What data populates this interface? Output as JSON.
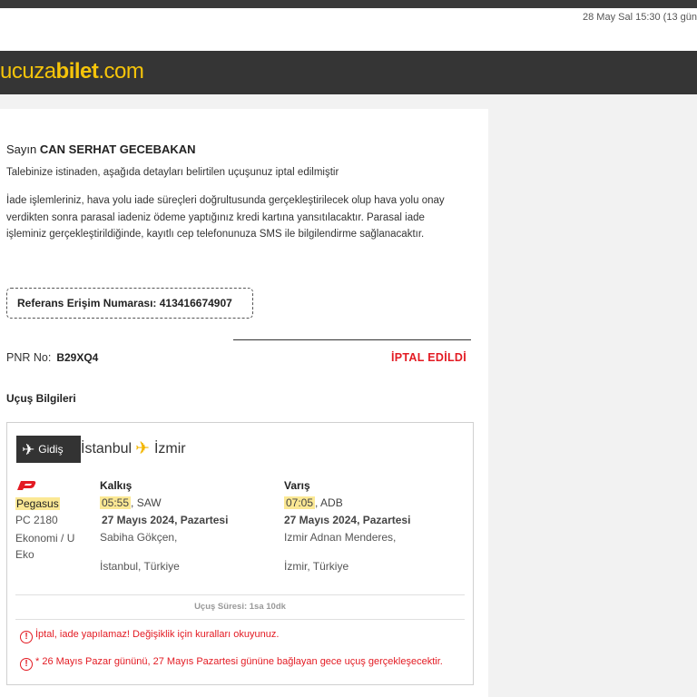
{
  "mail": {
    "date": "28 May Sal 15:30 (13 gün"
  },
  "brand": {
    "logo_part1": "ucuza",
    "logo_part2": "bilet",
    "logo_part3": ".com",
    "color": "#f5c40a"
  },
  "greeting": {
    "prefix": "Sayın",
    "name": "CAN SERHAT GECEBAKAN"
  },
  "message": {
    "line1": "Talebinize istinaden, aşağıda detayları belirtilen uçuşunuz iptal edilmiştir",
    "line2": "İade işlemleriniz, hava yolu iade süreçleri doğrultusunda gerçekleştirilecek olup hava yolu onay verdikten sonra parasal iadeniz ödeme yaptığınız kredi kartına yansıtılacaktır. Parasal iade işleminiz gerçekleştirildiğinde, kayıtlı cep telefonunuza SMS ile bilgilendirme sağlanacaktır."
  },
  "reference": {
    "text": "Referans Erişim Numarası: 413416674907"
  },
  "pnr": {
    "label": "PNR No:",
    "value": "B29XQ4",
    "status": "İPTAL EDİLDİ",
    "status_color": "#e31b23"
  },
  "flight_section": {
    "title": "Uçuş Bilgileri"
  },
  "flight": {
    "direction_label": "Gidiş",
    "from_city": "İstanbul",
    "to_city": "İzmir",
    "airline": "Pegasus",
    "flight_no": "PC 2180",
    "cabin": "Ekonomi / U Eko",
    "departure": {
      "label": "Kalkış",
      "time": "05:55",
      "airport_code": ", SAW",
      "date": "27 Mayıs 2024, Pazartesi",
      "airport": "Sabiha Gökçen,",
      "city": "İstanbul, Türkiye"
    },
    "arrival": {
      "label": "Varış",
      "time": "07:05",
      "airport_code": ", ADB",
      "date": "27 Mayıs 2024, Pazartesi",
      "airport": "Izmir Adnan Menderes,",
      "city": "İzmir, Türkiye"
    },
    "duration": "Uçuş Süresi: 1sa 10dk"
  },
  "warnings": [
    "İptal, iade yapılamaz! Değişiklik için kuralları okuyunuz.",
    "* 26 Mayıs Pazar gününü, 27 Mayıs Pazartesi gününe bağlayan gece uçuş gerçekleşecektir."
  ],
  "colors": {
    "accent": "#f3b600",
    "highlight": "#fbe894",
    "dark": "#353535",
    "error": "#e31b23"
  }
}
